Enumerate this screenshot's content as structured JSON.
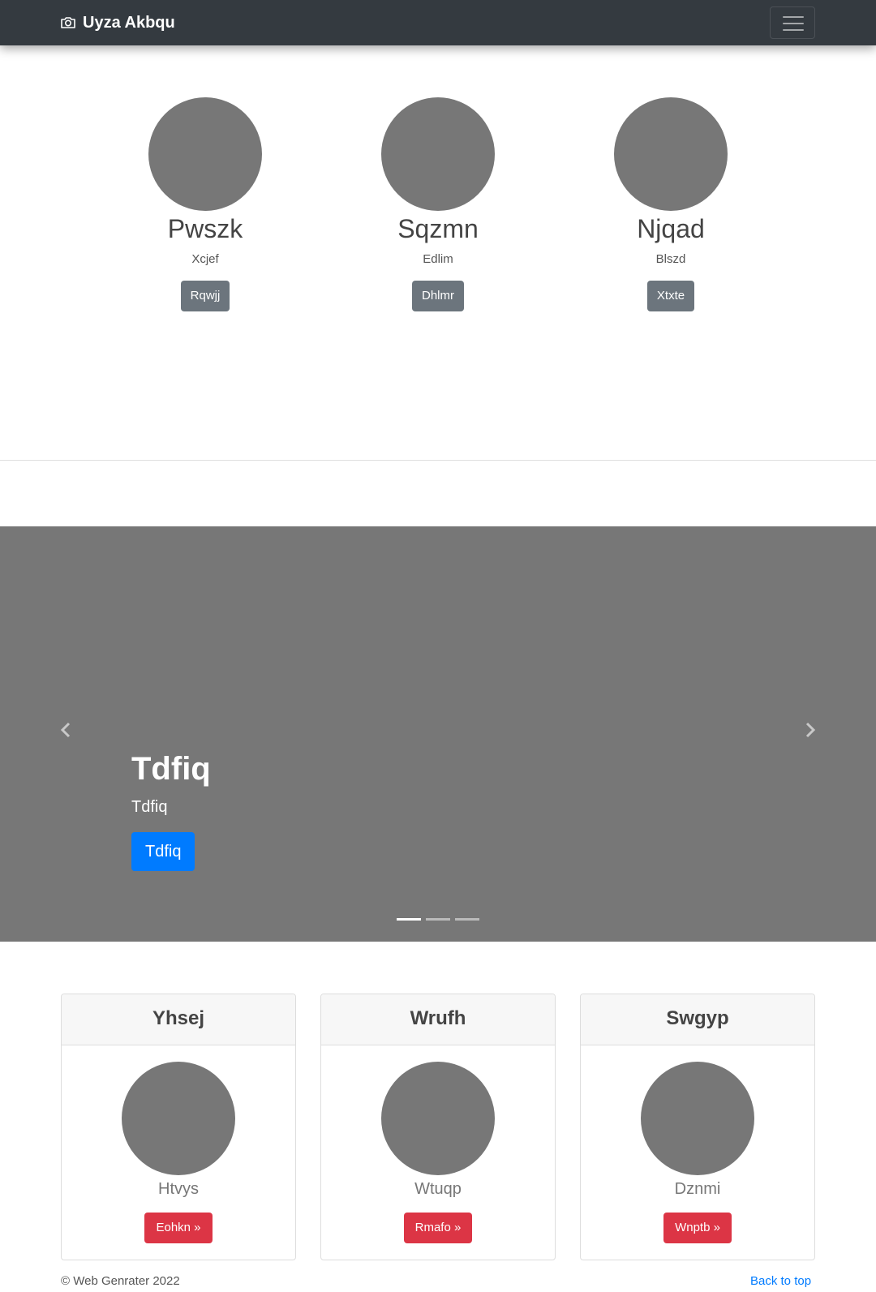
{
  "navbar": {
    "brand": "Uyza Akbqu",
    "brand_icon": "camera-icon",
    "toggler_icon": "hamburger-icon"
  },
  "profiles": [
    {
      "name": "Pwszk",
      "subtitle": "Xcjef",
      "button": "Rqwjj"
    },
    {
      "name": "Sqzmn",
      "subtitle": "Edlim",
      "button": "Dhlmr"
    },
    {
      "name": "Njqad",
      "subtitle": "Blszd",
      "button": "Xtxte"
    }
  ],
  "carousel": {
    "title": "Tdfiq",
    "text": "Tdfiq",
    "button": "Tdfiq",
    "slide_count": 3,
    "active_slide": 1
  },
  "cards": [
    {
      "header": "Yhsej",
      "subtitle": "Htvys",
      "button": "Eohkn »"
    },
    {
      "header": "Wrufh",
      "subtitle": "Wtuqp",
      "button": "Rmafo »"
    },
    {
      "header": "Swgyp",
      "subtitle": "Dznmi",
      "button": "Wnptb »"
    }
  ],
  "footer": {
    "copyright": "© Web Genrater 2022",
    "back_to_top": "Back to top"
  },
  "colors": {
    "navbar": "#343a40",
    "placeholder": "#777777",
    "secondary_button": "#6c757d",
    "primary_button": "#007bff",
    "danger_button": "#dc3545"
  }
}
